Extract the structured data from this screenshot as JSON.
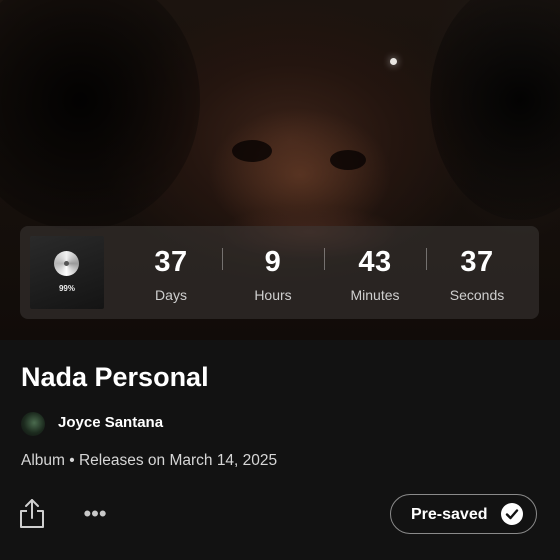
{
  "countdown": {
    "thumb_percent": "99%",
    "units": [
      {
        "value": "37",
        "label": "Days"
      },
      {
        "value": "9",
        "label": "Hours"
      },
      {
        "value": "43",
        "label": "Minutes"
      },
      {
        "value": "37",
        "label": "Seconds"
      }
    ]
  },
  "release": {
    "title": "Nada Personal",
    "artist": "Joyce Santana",
    "meta": "Album • Releases on March 14, 2025"
  },
  "actions": {
    "more_label": "•••",
    "presave_label": "Pre-saved"
  },
  "icons": {
    "share": "share-icon",
    "more": "more-options-icon",
    "check": "check-circle-icon",
    "disc": "disc-icon"
  },
  "colors": {
    "background": "#121212",
    "text_primary": "#ffffff",
    "text_secondary": "#d6d6d6"
  }
}
